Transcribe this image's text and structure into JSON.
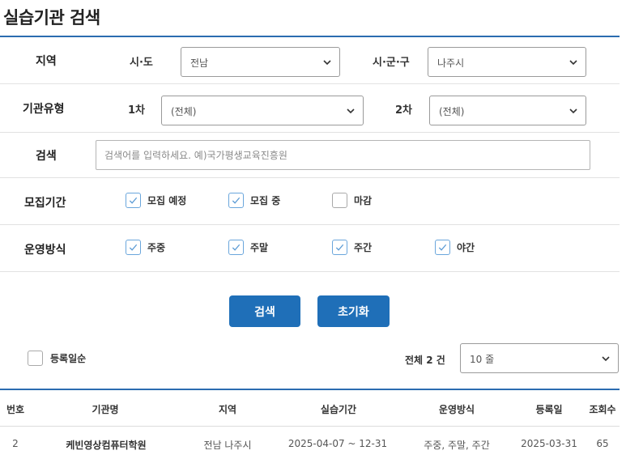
{
  "page": {
    "title": "실습기관 검색"
  },
  "filters": {
    "region": {
      "label": "지역",
      "sido_label": "시·도",
      "sido_value": "전남",
      "sigungu_label": "시·군·구",
      "sigungu_value": "나주시"
    },
    "org_type": {
      "label": "기관유형",
      "first_label": "1차",
      "first_value": "(전체)",
      "second_label": "2차",
      "second_value": "(전체)"
    },
    "search": {
      "label": "검색",
      "placeholder": "검색어를 입력하세요. 예)국가평생교육진흥원",
      "value": ""
    },
    "recruit_period": {
      "label": "모집기간",
      "options": [
        {
          "label": "모집 예정",
          "checked": true
        },
        {
          "label": "모집 중",
          "checked": true
        },
        {
          "label": "마감",
          "checked": false
        }
      ]
    },
    "operation": {
      "label": "운영방식",
      "options": [
        {
          "label": "주중",
          "checked": true
        },
        {
          "label": "주말",
          "checked": true
        },
        {
          "label": "주간",
          "checked": true
        },
        {
          "label": "야간",
          "checked": true
        }
      ]
    }
  },
  "buttons": {
    "search": "검색",
    "reset": "초기화"
  },
  "list_controls": {
    "sort_label": "등록일순",
    "sort_checked": false,
    "total_text": "전체 2 건",
    "page_size": "10 줄"
  },
  "table": {
    "headers": [
      "번호",
      "기관명",
      "지역",
      "실습기간",
      "운영방식",
      "등록일",
      "조회수"
    ],
    "rows": [
      [
        "2",
        "케빈영상컴퓨터학원",
        "전남 나주시",
        "2025-04-07 ~ 12-31",
        "주중, 주말, 주간",
        "2025-03-31",
        "65"
      ]
    ]
  },
  "colors": {
    "accent": "#1f6fb8",
    "rule": "#2b6cb0",
    "checkbox_border": "#6aa6dc"
  }
}
